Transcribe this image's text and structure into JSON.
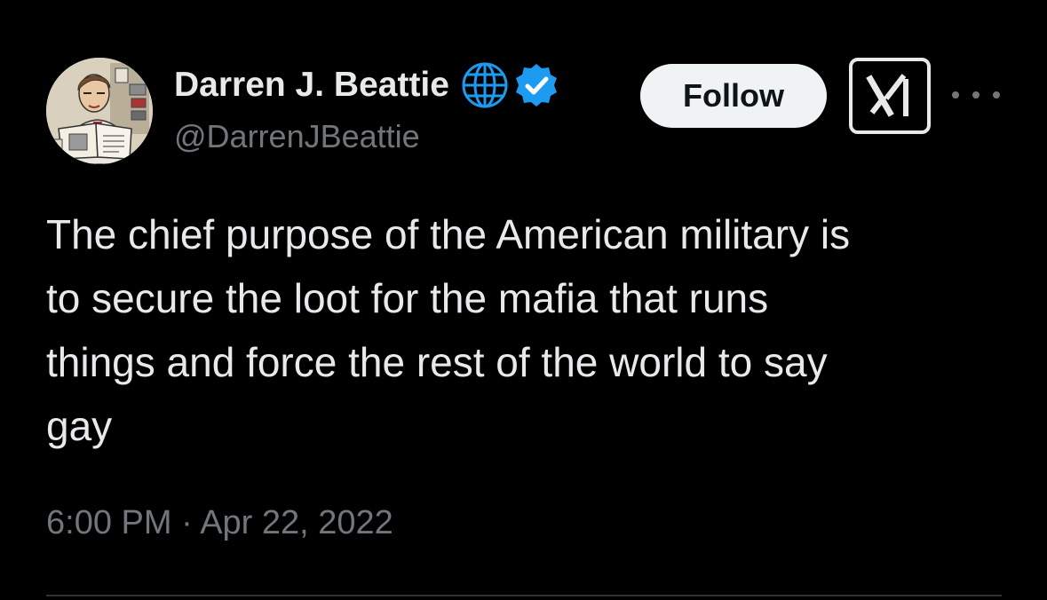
{
  "author": {
    "display_name": "Darren J. Beattie",
    "handle": "@DarrenJBeattie",
    "avatar": "illustrated-portrait-reading-book-avatar",
    "badges": [
      "globe-icon",
      "verified-icon"
    ]
  },
  "actions": {
    "follow_label": "Follow",
    "grok_icon": "grok-icon",
    "more_icon": "more-icon"
  },
  "tweet": {
    "lines": [
      "The chief purpose of the American military is",
      "to secure the loot for the mafia that runs",
      "things and force the rest of the world to say",
      "gay"
    ],
    "timestamp": "6:00 PM · Apr 22, 2022"
  },
  "colors": {
    "background": "#000000",
    "text_primary": "#e7e9ea",
    "text_secondary": "#71767b",
    "verified_blue": "#1d9bf0",
    "follow_bg": "#eff3f4",
    "divider": "#2f3336"
  }
}
